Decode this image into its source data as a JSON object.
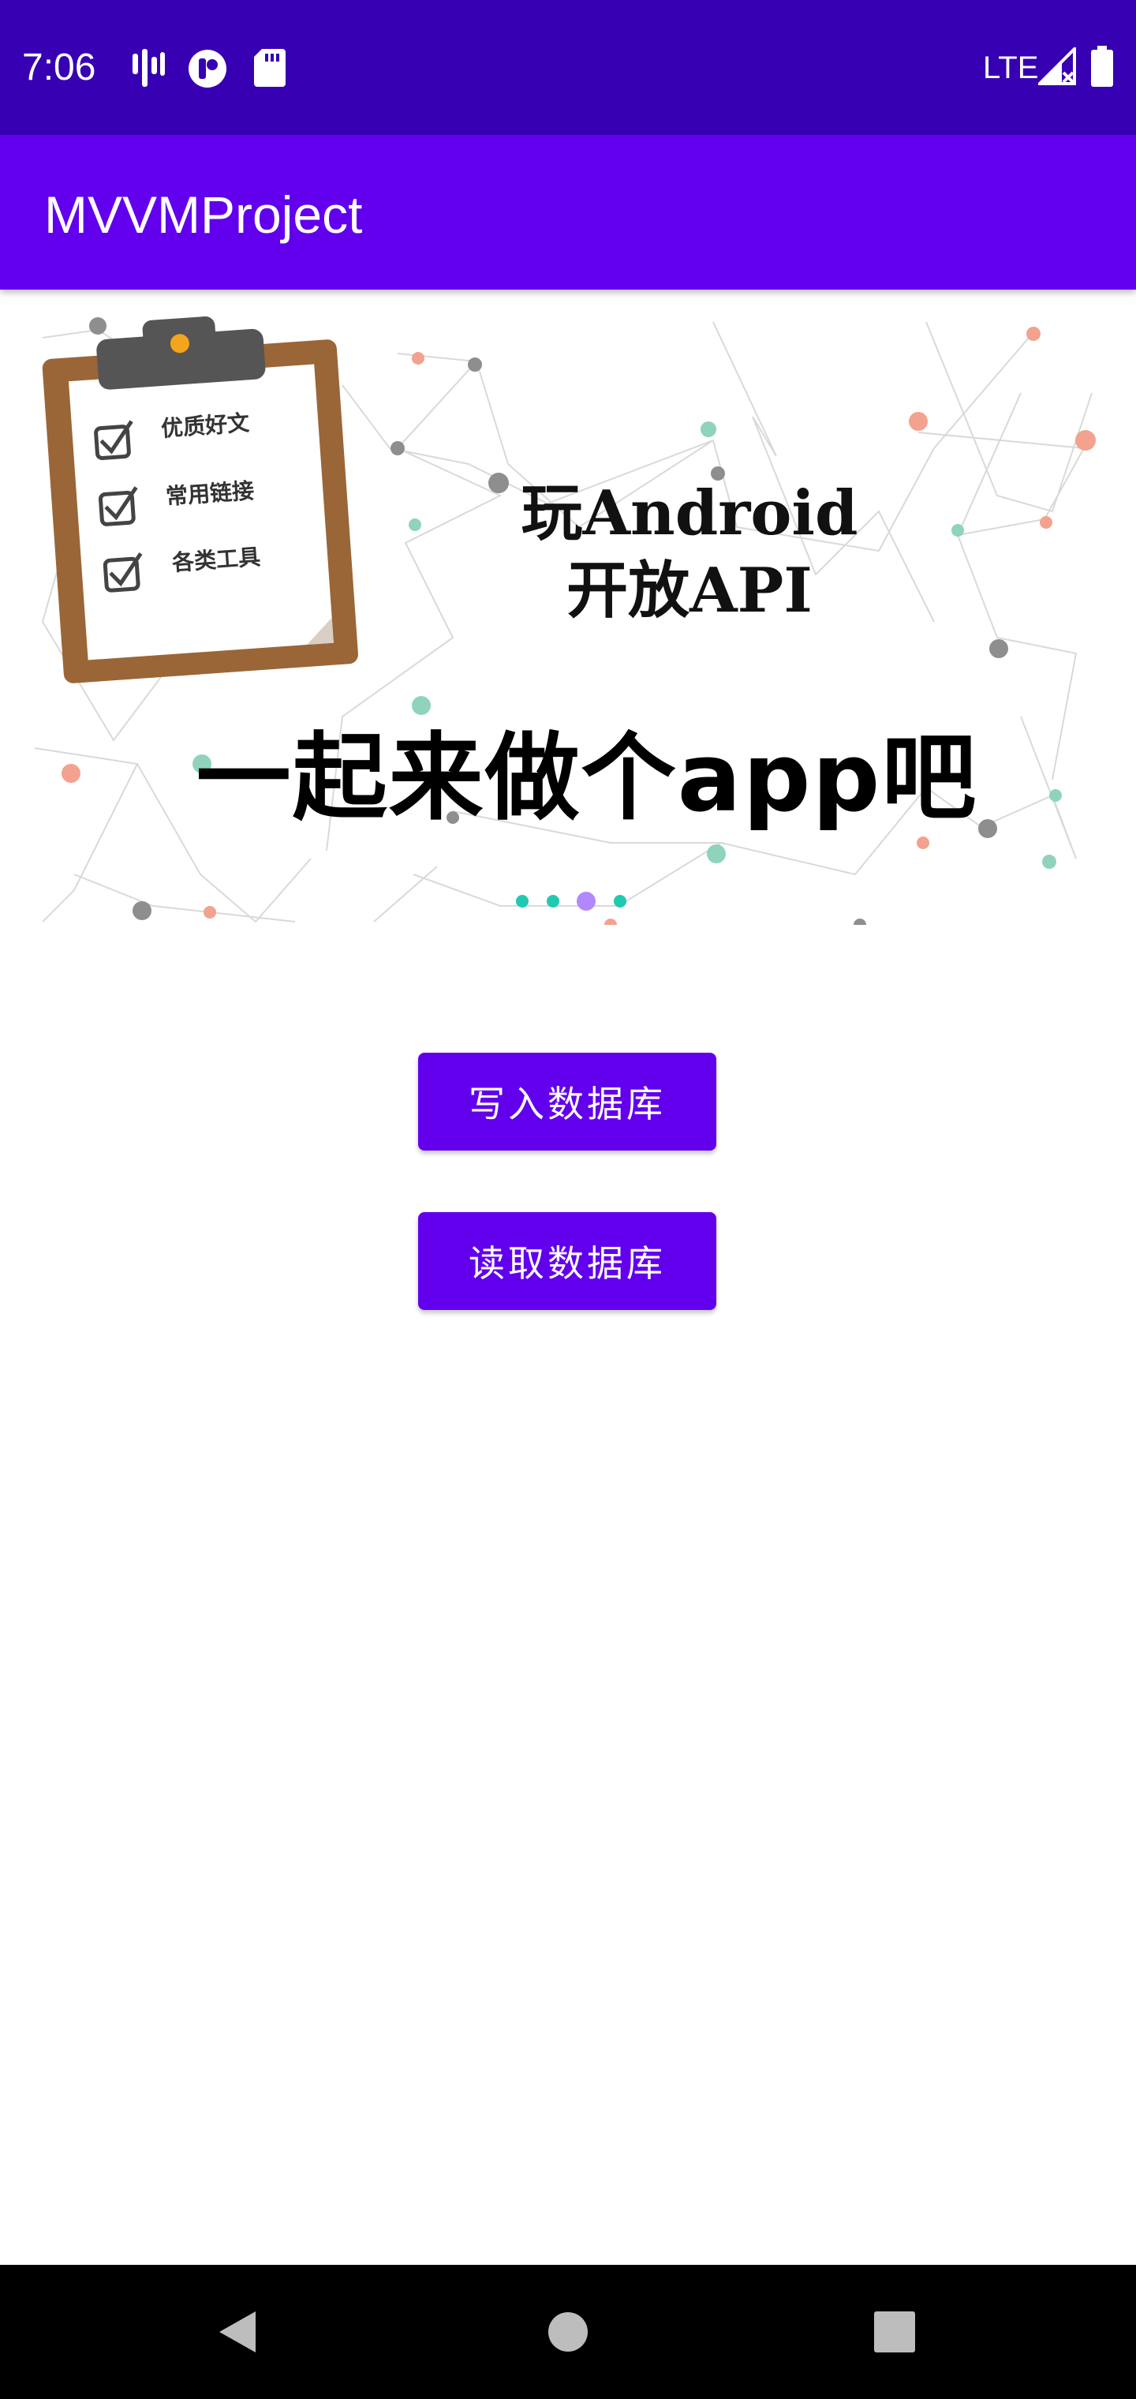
{
  "status_bar": {
    "time": "7:06",
    "network": "LTE",
    "icons": [
      "wave-icon",
      "app-icon",
      "sd-card-icon",
      "signal-icon",
      "battery-icon"
    ],
    "background": "#3700b3"
  },
  "app_bar": {
    "title": "MVVMProject",
    "background": "#6200ee"
  },
  "banner": {
    "headline_line1": "玩Android",
    "headline_line2": "开放API",
    "slogan": "一起来做个app吧",
    "clipboard_items": [
      "优质好文",
      "常用链接",
      "各类工具"
    ],
    "indicator_count": 4,
    "indicator_active_index": 2,
    "indicator_color": "#20c9b0",
    "indicator_active_color": "#b388ff"
  },
  "buttons": {
    "write_label": "写入数据库",
    "read_label": "读取数据库",
    "color": "#6200ee"
  },
  "nav_bar": {
    "icons": [
      "back-icon",
      "home-icon",
      "recents-icon"
    ]
  }
}
